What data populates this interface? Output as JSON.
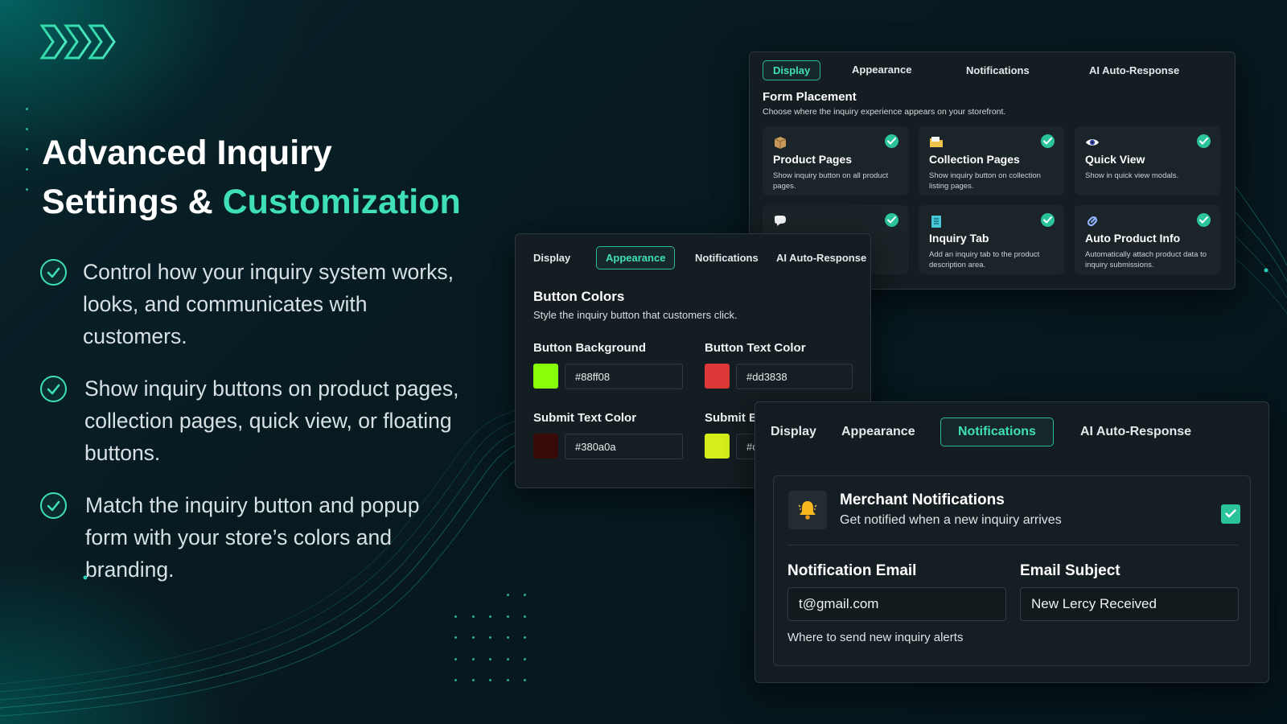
{
  "headline": {
    "line1": "Advanced Inquiry",
    "line2_prefix": "Settings & ",
    "line2_accent": "Customization"
  },
  "features": [
    "Control how your inquiry system works, looks, and communicates with customers.",
    "Show inquiry buttons on product pages, collection pages, quick view, or floating buttons.",
    "Match the inquiry button and popup form with your store’s colors and branding."
  ],
  "display_panel": {
    "tabs": [
      "Display",
      "Appearance",
      "Notifications",
      "AI Auto-Response"
    ],
    "active_tab": "Display",
    "section_title": "Form Placement",
    "section_subtitle": "Choose where the inquiry experience appears on your storefront.",
    "cards": [
      {
        "icon": "package-icon",
        "title": "Product Pages",
        "desc": "Show inquiry button on all product pages.",
        "checked": true
      },
      {
        "icon": "folder-icon",
        "title": "Collection Pages",
        "desc": "Show inquiry button on collection listing pages.",
        "checked": true
      },
      {
        "icon": "eye-icon",
        "title": "Quick View",
        "desc": "Show in quick view modals.",
        "checked": true
      },
      {
        "icon": "chat-bubble-icon",
        "title": "",
        "desc": "on every",
        "checked": true
      },
      {
        "icon": "notepad-icon",
        "title": "Inquiry Tab",
        "desc": "Add an inquiry tab to the product description area.",
        "checked": true
      },
      {
        "icon": "link-icon",
        "title": "Auto Product Info",
        "desc": "Automatically attach product data to inquiry submissions.",
        "checked": true
      }
    ]
  },
  "appearance_panel": {
    "tabs": [
      "Display",
      "Appearance",
      "Notifications",
      "AI Auto-Response"
    ],
    "active_tab": "Appearance",
    "section_title": "Button Colors",
    "section_subtitle": "Style the inquiry button that customers click.",
    "fields": [
      {
        "label": "Button Background",
        "value": "#88ff08",
        "swatch": "#88ff08"
      },
      {
        "label": "Button Text Color",
        "value": "#dd3838",
        "swatch": "#dd3838"
      },
      {
        "label": "Submit Text Color",
        "value": "#380a0a",
        "swatch": "#380a0a"
      },
      {
        "label": "Submit B",
        "value": "#c",
        "swatch": "#d4ef1a"
      }
    ]
  },
  "notifications_panel": {
    "tabs": [
      "Display",
      "Appearance",
      "Notifications",
      "AI Auto-Response"
    ],
    "active_tab": "Notifications",
    "merchant": {
      "title": "Merchant Notifications",
      "subtitle": "Get notified when a new inquiry arrives",
      "checked": true
    },
    "email_label": "Notification Email",
    "email_value": "t@gmail.com",
    "email_hint": "Where to send new inquiry alerts",
    "subject_label": "Email Subject",
    "subject_value": "New Lercy Received"
  },
  "colors": {
    "accent": "#3fe0b5",
    "check_green": "#2bc39c",
    "panel_bg": "#141d21",
    "page_bg": "#071a20"
  }
}
